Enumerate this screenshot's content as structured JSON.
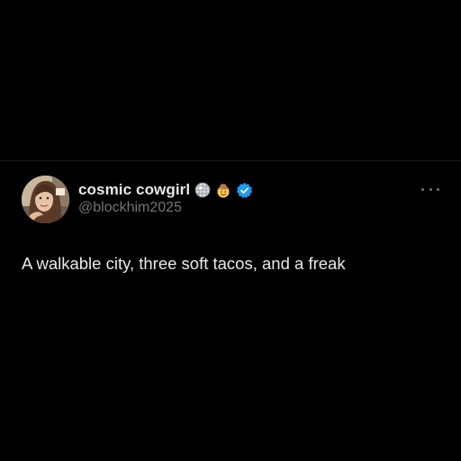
{
  "tweet": {
    "author": {
      "display_name": "cosmic cowgirl",
      "handle": "@blockhim2025",
      "emojis": [
        "disco-ball-icon",
        "cowboy-face-icon"
      ],
      "verified": true,
      "avatar": "profile-photo"
    },
    "text": "A walkable city, three soft tacos, and a freak",
    "more_icon": "more-horizontal-icon"
  },
  "colors": {
    "background": "#000000",
    "primary_text": "#e7e9ea",
    "secondary_text": "#71767b",
    "verified_blue": "#1d9bf0"
  }
}
